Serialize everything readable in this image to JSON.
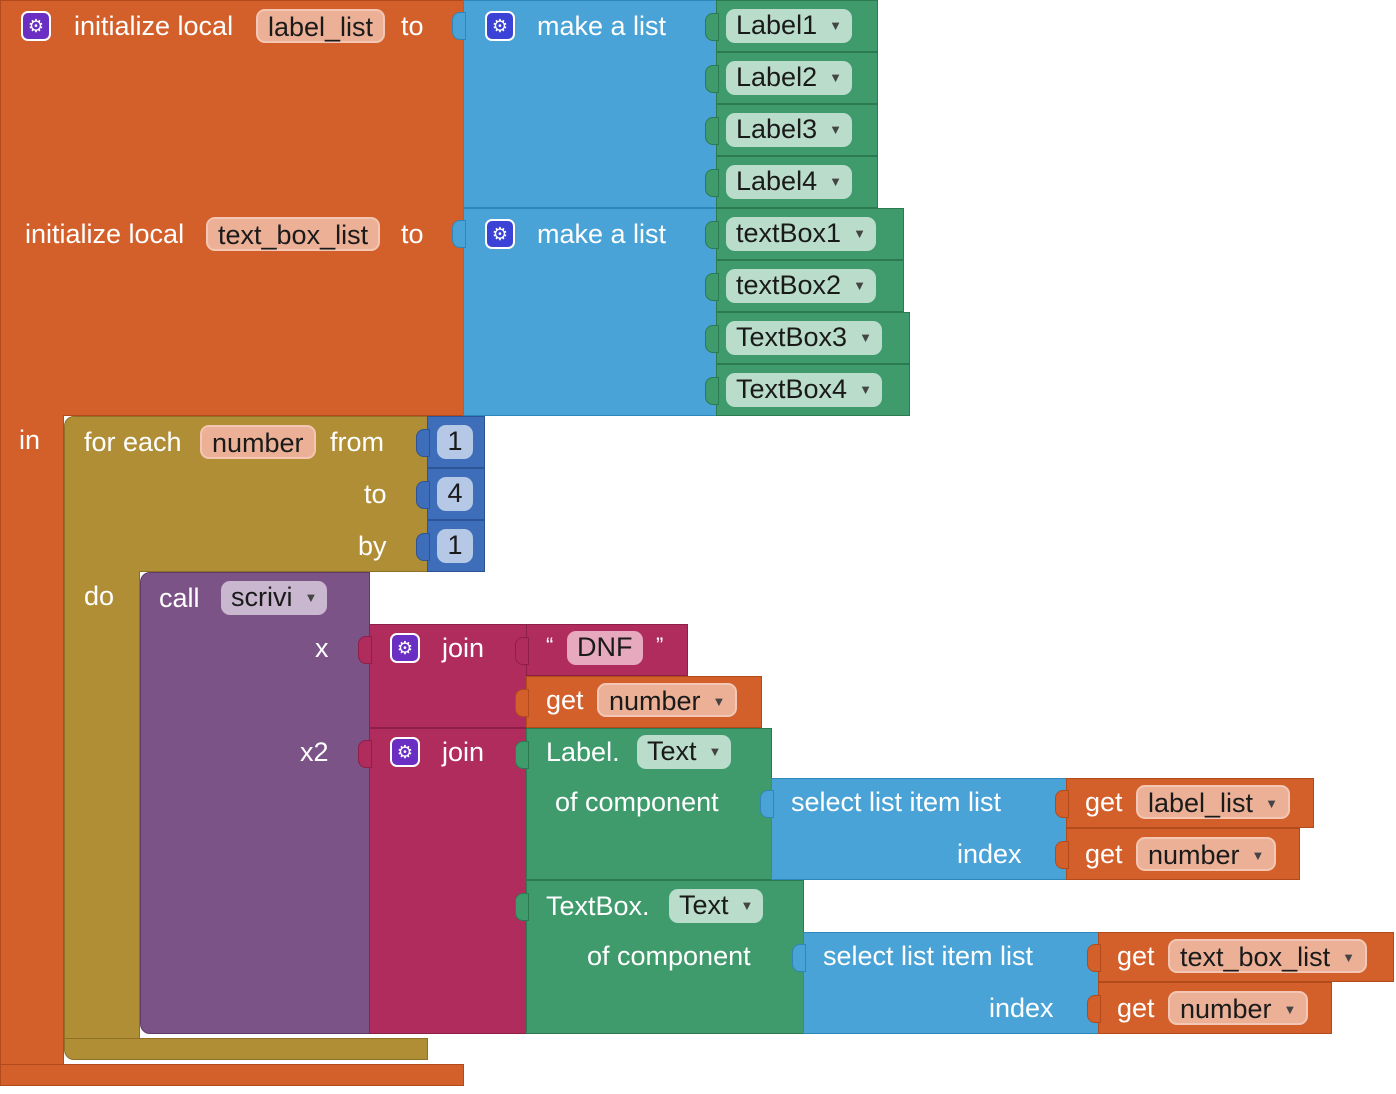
{
  "icons": {
    "gear": "⚙",
    "dropdown": "▼"
  },
  "init1": {
    "prefix": "initialize local",
    "var_name": "label_list",
    "to": "to",
    "make_list": "make a list",
    "items": [
      "Label1",
      "Label2",
      "Label3",
      "Label4"
    ]
  },
  "init2": {
    "prefix": "initialize local",
    "var_name": "text_box_list",
    "to": "to",
    "make_list": "make a list",
    "items": [
      "textBox1",
      "textBox2",
      "TextBox3",
      "TextBox4"
    ]
  },
  "in_label": "in",
  "loop": {
    "for_each": "for each",
    "var_name": "number",
    "from_label": "from",
    "from_value": "1",
    "to_label": "to",
    "to_value": "4",
    "by_label": "by",
    "by_value": "1",
    "do_label": "do"
  },
  "call": {
    "call_label": "call",
    "proc_name": "scrivi",
    "arg_x": "x",
    "arg_x2": "x2"
  },
  "join1": {
    "join": "join",
    "open_quote": "“",
    "text": "DNF",
    "close_quote": "”",
    "get": "get",
    "var": "number"
  },
  "join2": {
    "join": "join",
    "label_text": {
      "component": "Label.",
      "property": "Text",
      "of_component": "of component",
      "select": "select list item  list",
      "index": "index",
      "get": "get",
      "list_var": "label_list",
      "index_var": "number"
    },
    "textbox_text": {
      "component": "TextBox.",
      "property": "Text",
      "of_component": "of component",
      "select": "select list item  list",
      "index": "index",
      "get": "get",
      "list_var": "text_box_list",
      "index_var": "number"
    }
  },
  "colors": {
    "variable": "#D35F2B",
    "list": "#4AA3D6",
    "component": "#3F9A6C",
    "control": "#B08E36",
    "procedure": "#7C5386",
    "text": "#B02C5C",
    "math": "#3E6EBA"
  }
}
